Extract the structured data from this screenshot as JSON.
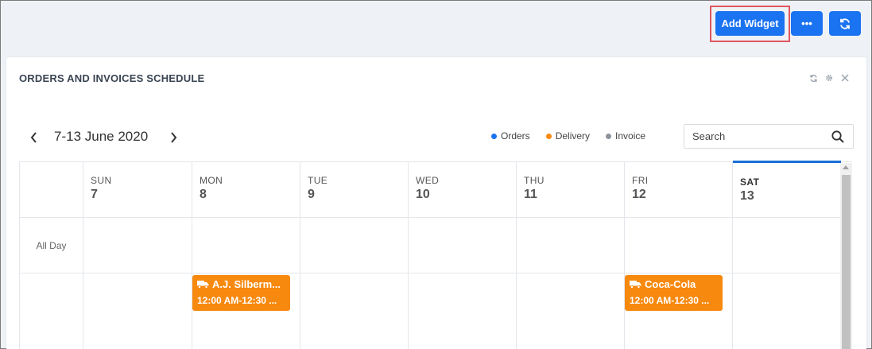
{
  "toolbar": {
    "add_widget_label": "Add Widget",
    "more_label": "•••",
    "refresh_icon": "refresh-icon"
  },
  "widget": {
    "title": "ORDERS AND INVOICES SCHEDULE",
    "header_icons": [
      "refresh-icon",
      "gear-icon",
      "close-icon"
    ]
  },
  "calendar": {
    "date_range": "7-13 June 2020",
    "prev_icon": "chevron-left-icon",
    "next_icon": "chevron-right-icon",
    "legend": [
      {
        "label": "Orders",
        "color": "#1a73f0"
      },
      {
        "label": "Delivery",
        "color": "#f7890f"
      },
      {
        "label": "Invoice",
        "color": "#8d939a"
      }
    ],
    "search_placeholder": "Search",
    "all_day_label": "All Day",
    "days": [
      {
        "name": "SUN",
        "num": "7"
      },
      {
        "name": "MON",
        "num": "8"
      },
      {
        "name": "TUE",
        "num": "9"
      },
      {
        "name": "WED",
        "num": "10"
      },
      {
        "name": "THU",
        "num": "11"
      },
      {
        "name": "FRI",
        "num": "12"
      },
      {
        "name": "SAT",
        "num": "13"
      }
    ],
    "today_index": 6,
    "events": [
      {
        "day": "MON",
        "title": "A.J. Silberm...",
        "time": "12:00 AM-12:30 ...",
        "type": "Delivery",
        "icon": "truck-icon"
      },
      {
        "day": "FRI",
        "title": "Coca-Cola",
        "time": "12:00 AM-12:30 ...",
        "type": "Delivery",
        "icon": "truck-icon"
      }
    ]
  },
  "colors": {
    "accent": "#1a73f0",
    "delivery": "#f7890f",
    "highlight": "#e0575e",
    "today_bar": "#1a6fd8"
  }
}
